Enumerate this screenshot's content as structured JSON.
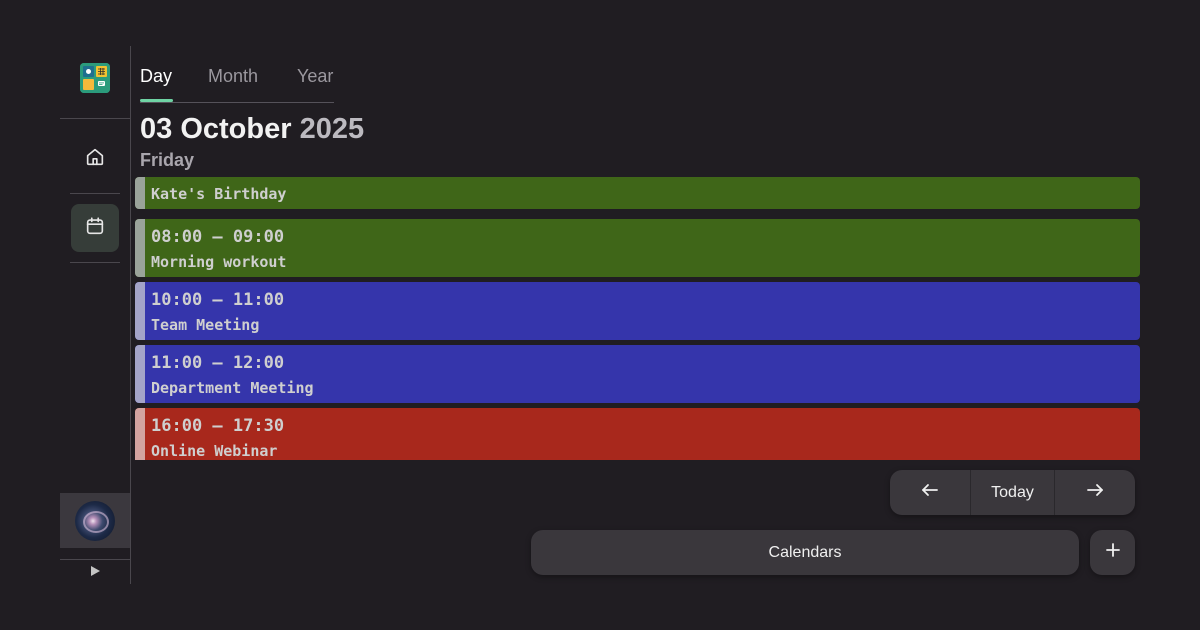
{
  "tabs": [
    {
      "label": "Day",
      "active": true
    },
    {
      "label": "Month",
      "active": false
    },
    {
      "label": "Year",
      "active": false
    }
  ],
  "header": {
    "day_month": "03 October",
    "year": "2025",
    "weekday": "Friday"
  },
  "sidebar": {
    "logo_icon": "calendar-app-logo-icon",
    "items": [
      {
        "icon": "home-icon",
        "active": false
      },
      {
        "icon": "calendar-icon",
        "active": true
      }
    ],
    "expand_icon": "play-triangle-icon"
  },
  "events": [
    {
      "all_day": true,
      "time": "",
      "title": "Kate's Birthday",
      "color": "#3f6618",
      "stripe": "#9aa39a"
    },
    {
      "all_day": false,
      "time": "08:00 – 09:00",
      "title": "Morning workout",
      "color": "#3f6618",
      "stripe": "#9aa39a"
    },
    {
      "all_day": false,
      "time": "10:00 – 11:00",
      "title": "Team Meeting",
      "color": "#3535ab",
      "stripe": "#a4a4c8"
    },
    {
      "all_day": false,
      "time": "11:00 – 12:00",
      "title": "Department Meeting",
      "color": "#3535ab",
      "stripe": "#a4a4c8"
    },
    {
      "all_day": false,
      "time": "16:00 – 17:30",
      "title": "Online Webinar",
      "color": "#a8281c",
      "stripe": "#d3a3a0"
    }
  ],
  "controls": {
    "prev_icon": "arrow-left-icon",
    "today_label": "Today",
    "next_icon": "arrow-right-icon",
    "calendars_label": "Calendars",
    "add_icon": "plus-icon"
  },
  "colors": {
    "background": "#201d22",
    "accent": "#6fd3a4",
    "button_bg": "#3a373c"
  }
}
